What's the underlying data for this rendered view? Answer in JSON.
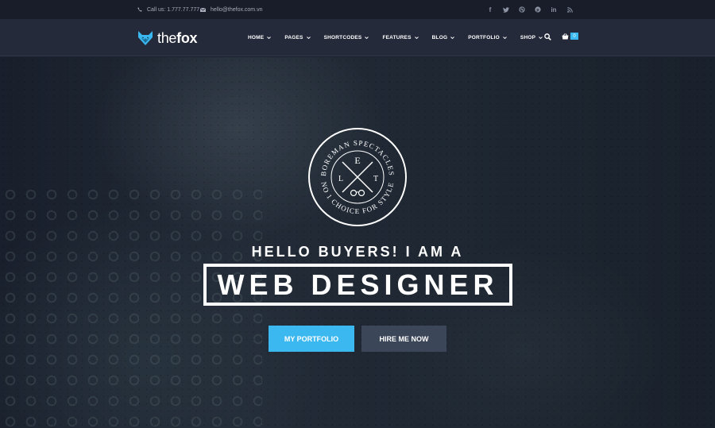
{
  "topbar": {
    "phone": "Call us: 1.777.77.777",
    "email": "hello@thefox.com.vn",
    "socials": [
      "facebook-icon",
      "twitter-icon",
      "dribbble-icon",
      "pinterest-icon",
      "linkedin-icon",
      "rss-icon"
    ]
  },
  "header": {
    "logo_prefix": "the",
    "logo_bold": "fox",
    "nav": [
      "HOME",
      "PAGES",
      "SHORTCODES",
      "FEATURES",
      "BLOG",
      "PORTFOLIO",
      "SHOP"
    ],
    "cart_count": "0"
  },
  "hero": {
    "badge": {
      "top_arc": "BOREMAN SPECTACLES",
      "bottom_arc": "NO 1 CHOICE FOR STYLE",
      "letters": [
        "E",
        "L",
        "T"
      ]
    },
    "hello": "HELLO BUYERS! I AM A",
    "title": "WEB DESIGNER",
    "primary_button": "MY PORTFOLIO",
    "secondary_button": "HIRE ME NOW"
  },
  "colors": {
    "accent": "#3cb8f0",
    "topbar": "#191d29",
    "navbar": "#252a3a",
    "secondary_button": "#3c4659"
  }
}
